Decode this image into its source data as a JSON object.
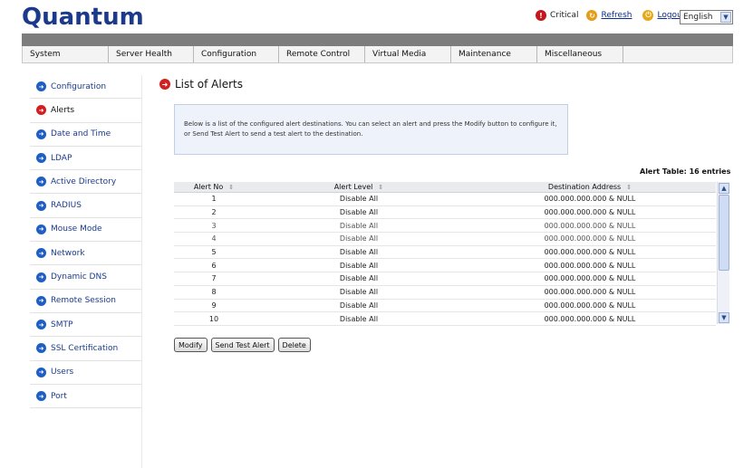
{
  "brand": {
    "logo_text": "Quantum",
    "color": "#1c3a8c"
  },
  "top_links": {
    "critical_label": "Critical",
    "refresh_label": "Refresh",
    "logout_label": "Logout",
    "language_value": "English"
  },
  "menu": [
    {
      "label": "System"
    },
    {
      "label": "Server Health"
    },
    {
      "label": "Configuration"
    },
    {
      "label": "Remote Control"
    },
    {
      "label": "Virtual Media"
    },
    {
      "label": "Maintenance"
    },
    {
      "label": "Miscellaneous"
    }
  ],
  "sidebar": {
    "items": [
      {
        "label": "Configuration"
      },
      {
        "label": "Alerts",
        "active": true
      },
      {
        "label": "Date and Time"
      },
      {
        "label": "LDAP"
      },
      {
        "label": "Active Directory"
      },
      {
        "label": "RADIUS"
      },
      {
        "label": "Mouse Mode"
      },
      {
        "label": "Network"
      },
      {
        "label": "Dynamic DNS"
      },
      {
        "label": "Remote Session"
      },
      {
        "label": "SMTP"
      },
      {
        "label": "SSL Certification"
      },
      {
        "label": "Users"
      },
      {
        "label": "Port"
      }
    ]
  },
  "page": {
    "title": "List of Alerts",
    "info_text": "Below is a list of the configured alert destinations. You can select an alert and press the Modify button to configure it, or Send Test Alert to send a test alert to the destination.",
    "table_count": "Alert Table: 16 entries"
  },
  "table": {
    "columns": [
      "Alert No",
      "Alert Level",
      "Destination Address"
    ],
    "rows": [
      [
        "1",
        "Disable All",
        "000.000.000.000 & NULL"
      ],
      [
        "2",
        "Disable All",
        "000.000.000.000 & NULL"
      ],
      [
        "3",
        "Disable All",
        "000.000.000.000 & NULL"
      ],
      [
        "4",
        "Disable All",
        "000.000.000.000 & NULL"
      ],
      [
        "5",
        "Disable All",
        "000.000.000.000 & NULL"
      ],
      [
        "6",
        "Disable All",
        "000.000.000.000 & NULL"
      ],
      [
        "7",
        "Disable All",
        "000.000.000.000 & NULL"
      ],
      [
        "8",
        "Disable All",
        "000.000.000.000 & NULL"
      ],
      [
        "9",
        "Disable All",
        "000.000.000.000 & NULL"
      ],
      [
        "10",
        "Disable All",
        "000.000.000.000 & NULL"
      ]
    ]
  },
  "buttons": {
    "modify": "Modify",
    "send_test": "Send Test Alert",
    "delete": "Delete"
  }
}
